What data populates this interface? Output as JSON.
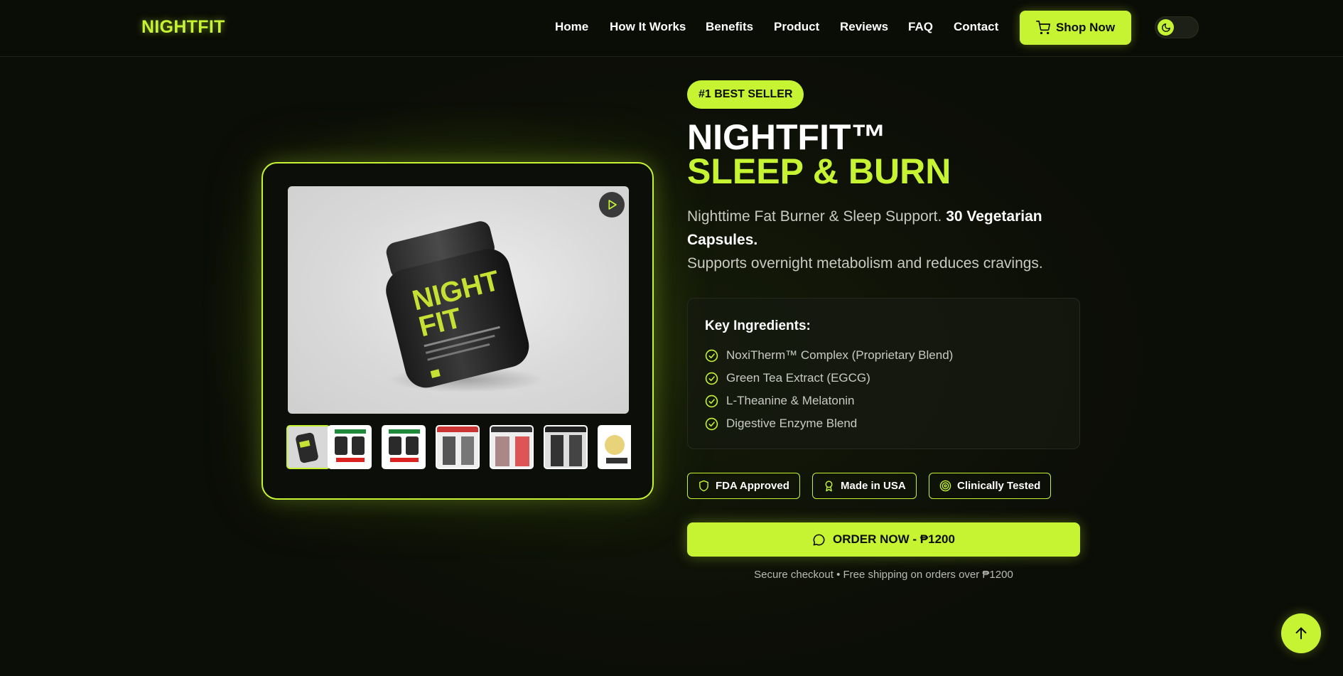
{
  "colors": {
    "accent": "#c6f432",
    "background": "#0b0d07",
    "text": "#ffffff",
    "muted": "#c9cbc2"
  },
  "header": {
    "logo": "NIGHTFIT",
    "nav": [
      "Home",
      "How It Works",
      "Benefits",
      "Product",
      "Reviews",
      "FAQ",
      "Contact"
    ],
    "shop_label": "Shop Now",
    "shop_icon": "cart-icon",
    "theme_icon": "moon-icon"
  },
  "gallery": {
    "play_icon": "play-icon",
    "thumbnail_count": 7,
    "active_thumbnail": 1
  },
  "product": {
    "badge": "#1 BEST SELLER",
    "title_line1": "NIGHTFIT™",
    "title_line2": "SLEEP & BURN",
    "desc_part1": "Nighttime Fat Burner & Sleep Support.",
    "desc_bold": "30 Vegetarian Capsules.",
    "desc_part2": "Supports overnight metabolism and reduces cravings.",
    "ingredients_title": "Key Ingredients:",
    "ingredients": [
      "NoxiTherm™ Complex (Proprietary Blend)",
      "Green Tea Extract (EGCG)",
      "L-Theanine & Melatonin",
      "Digestive Enzyme Blend"
    ],
    "certifications": [
      {
        "label": "FDA Approved",
        "icon": "shield-icon"
      },
      {
        "label": "Made in USA",
        "icon": "award-icon"
      },
      {
        "label": "Clinically Tested",
        "icon": "target-icon"
      }
    ],
    "order_label": "ORDER NOW - ₱1200",
    "order_icon": "chat-icon",
    "secure_note": "Secure checkout • Free shipping on orders over ₱1200"
  },
  "scroll_top_icon": "arrow-up-icon"
}
